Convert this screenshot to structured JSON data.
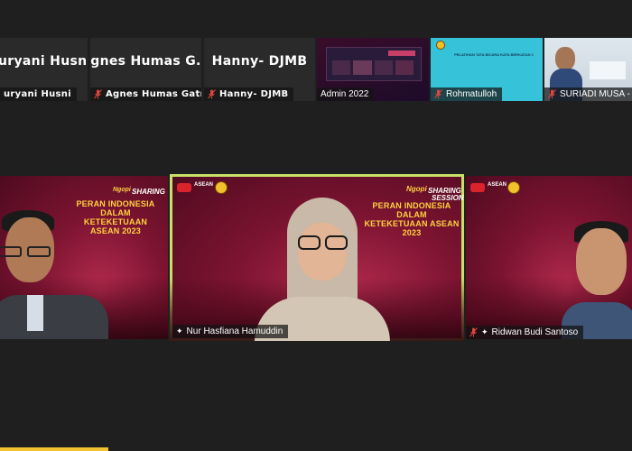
{
  "top_row": [
    {
      "display_name": "uryani Husni",
      "label": "uryani Husni",
      "muted": false
    },
    {
      "display_name": "Agnes  Humas  G...",
      "label": "Agnes Humas Gatrik",
      "muted": true
    },
    {
      "display_name": "Hanny- DJMB",
      "label": "Hanny- DJMB",
      "muted": true
    },
    {
      "label": "Admin 2022",
      "muted": false
    },
    {
      "label": "Rohmatulloh",
      "muted": true,
      "slide_heading": "PELATIHAN TATA BICARA KATA BERKATAN 1"
    },
    {
      "label": "SURIADI MUSA - E",
      "muted": true
    }
  ],
  "main_row": [
    {
      "label": "",
      "slide": "left"
    },
    {
      "label": "Nur Hasfiana Hamuddin",
      "muted": false,
      "pinned": true,
      "active_speaker": true
    },
    {
      "label": "Ridwan Budi Santoso",
      "muted": true,
      "pinned": true
    }
  ],
  "slide": {
    "title_line1": "PERAN INDONESIA DALAM",
    "title_line2": "KETEKETUAAN ASEAN 2023",
    "sharing": "SHARING",
    "session": "SESSION",
    "ngopi": "Ngopi",
    "asean": "ASEAN"
  },
  "colors": {
    "active_border": "#c8e06a",
    "slide_title": "#ffd23f",
    "mic_muted": "#e0463e"
  }
}
